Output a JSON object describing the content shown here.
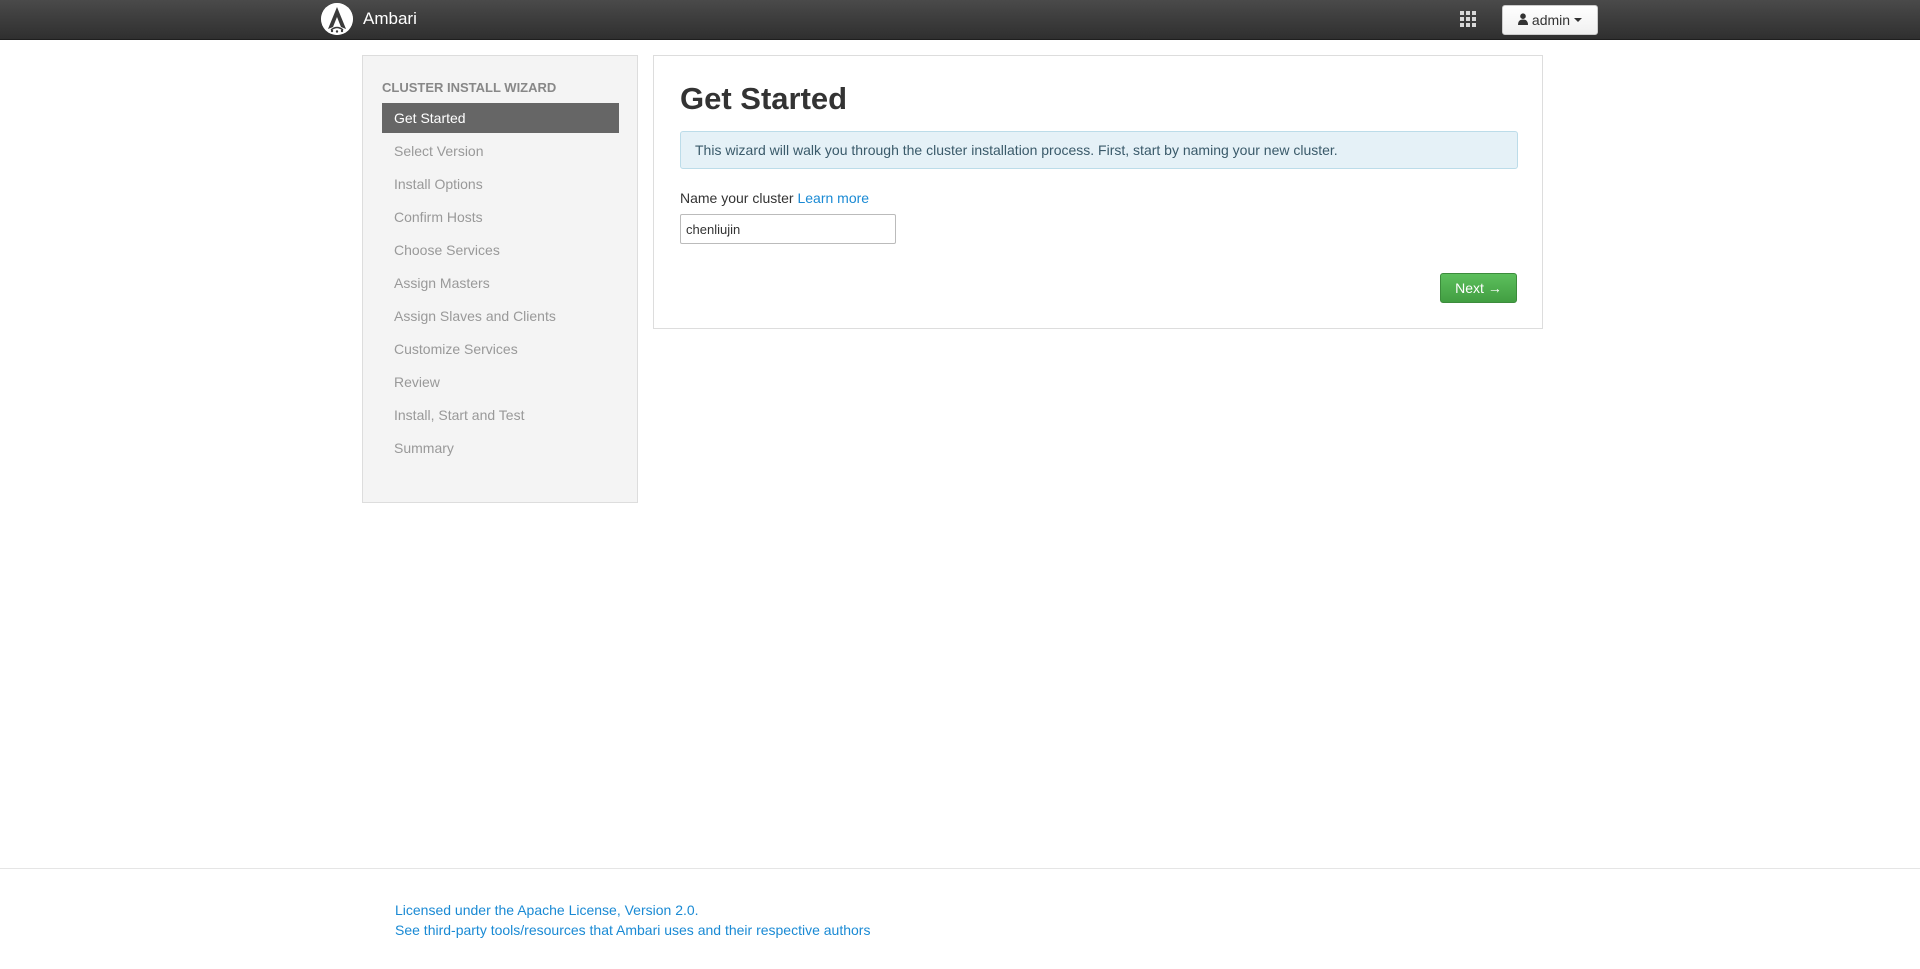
{
  "header": {
    "app_name": "Ambari",
    "logo_icon": "ambari-logo-icon",
    "apps_icon": "grid-icon",
    "user_menu_label": "admin",
    "user_icon": "user-icon",
    "navbar_color": "#333333"
  },
  "sidebar": {
    "title": "CLUSTER INSTALL WIZARD",
    "steps": [
      {
        "label": "Get Started",
        "active": true
      },
      {
        "label": "Select Version",
        "active": false
      },
      {
        "label": "Install Options",
        "active": false
      },
      {
        "label": "Confirm Hosts",
        "active": false
      },
      {
        "label": "Choose Services",
        "active": false
      },
      {
        "label": "Assign Masters",
        "active": false
      },
      {
        "label": "Assign Slaves and Clients",
        "active": false
      },
      {
        "label": "Customize Services",
        "active": false
      },
      {
        "label": "Review",
        "active": false
      },
      {
        "label": "Install, Start and Test",
        "active": false
      },
      {
        "label": "Summary",
        "active": false
      }
    ],
    "active_color": "#666666"
  },
  "main": {
    "title": "Get Started",
    "info_text": "This wizard will walk you through the cluster installation process. First, start by naming your new cluster.",
    "cluster_label": "Name your cluster",
    "learn_more_label": "Learn more",
    "cluster_name_value": "chenliujin",
    "next_label": "Next →",
    "next_color": "#4cae4c"
  },
  "footer": {
    "license_text": "Licensed under the Apache License, Version 2.0.",
    "third_party_text": "See third-party tools/resources that Ambari uses and their respective authors",
    "link_color": "#1a8ad4"
  }
}
